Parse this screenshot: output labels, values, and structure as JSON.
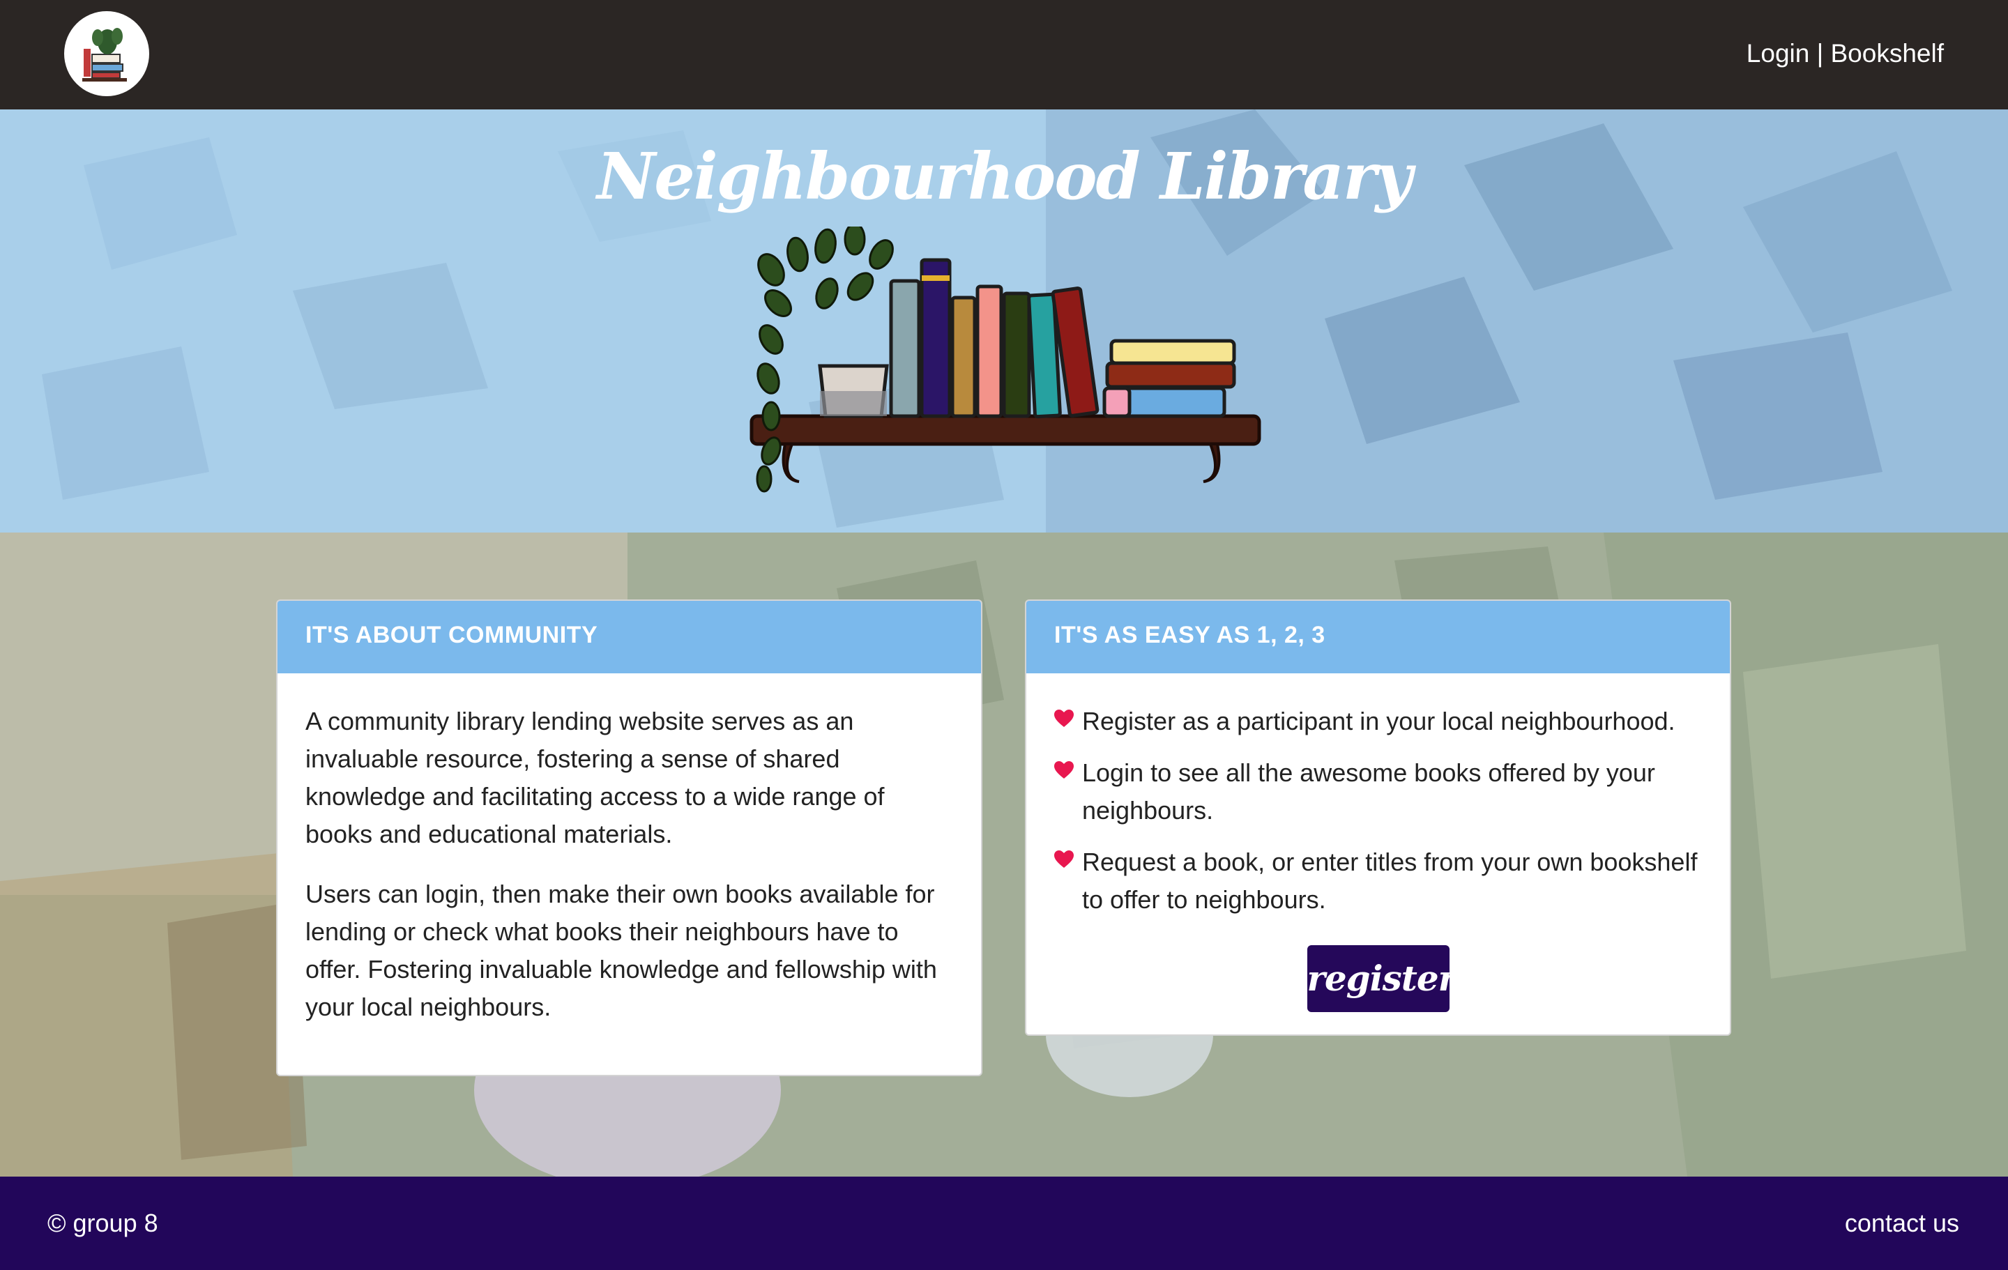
{
  "nav": {
    "login": "Login",
    "separator": " | ",
    "bookshelf": "Bookshelf"
  },
  "hero": {
    "title": "Neighbourhood Library"
  },
  "community_card": {
    "header": "IT'S ABOUT COMMUNITY",
    "paragraphs": [
      "A community library lending website serves as an invaluable resource, fostering a sense of shared knowledge and facilitating access to a wide range of books and educational materials.",
      "Users can login, then make their own books available for lending or check what books their neighbours have to offer. Fostering invaluable knowledge and fellowship with your local neighbours."
    ]
  },
  "steps_card": {
    "header": "IT'S AS EASY AS 1, 2, 3",
    "steps": [
      "Register as a participant in your local neighbourhood.",
      "Login to see all the awesome books offered by your neighbours.",
      "Request a book, or enter titles from your own bookshelf to offer to neighbours."
    ],
    "register_label": "register"
  },
  "footer": {
    "copyright": "© group 8",
    "contact": "contact us"
  },
  "colors": {
    "navbar": "#2b2624",
    "card_header": "#7bb9ec",
    "button": "#25085a",
    "footer": "#22065a",
    "heart": "#e8174f"
  }
}
